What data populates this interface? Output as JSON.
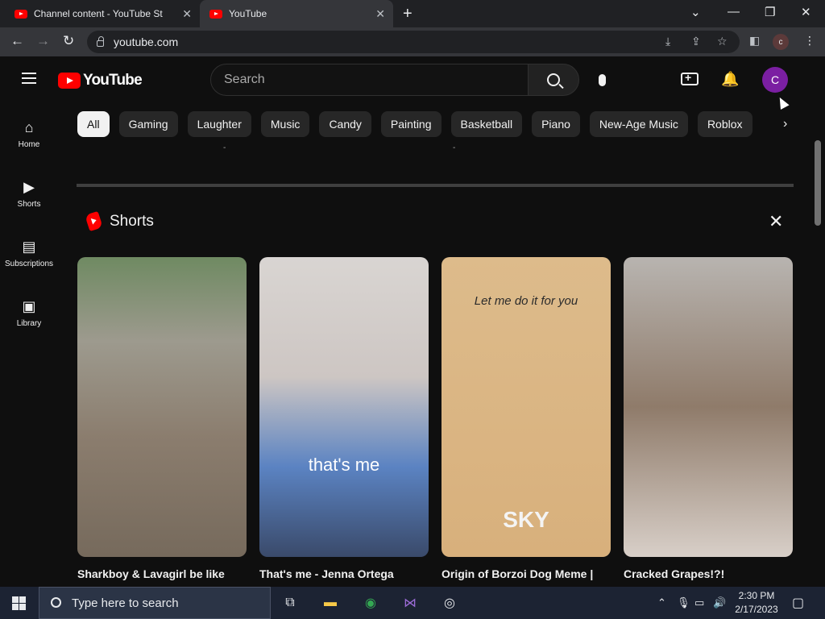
{
  "browser": {
    "tabs": [
      {
        "label": "Channel content - YouTube Studio"
      },
      {
        "label": "YouTube"
      }
    ],
    "url": "youtube.com",
    "profile_initial": "c"
  },
  "header": {
    "logo_text": "YouTube",
    "search_placeholder": "Search",
    "avatar_initial": "C"
  },
  "guide": [
    {
      "label": "Home",
      "icon": "home-icon"
    },
    {
      "label": "Shorts",
      "icon": "shorts-icon"
    },
    {
      "label": "Subscriptions",
      "icon": "subscriptions-icon"
    },
    {
      "label": "Library",
      "icon": "library-icon"
    }
  ],
  "chips": [
    "All",
    "Gaming",
    "Laughter",
    "Music",
    "Candy",
    "Painting",
    "Basketball",
    "Piano",
    "New-Age Music",
    "Roblox"
  ],
  "shorts": {
    "title": "Shorts",
    "items": [
      {
        "title": "Sharkboy & Lavagirl be like",
        "overlay": ""
      },
      {
        "title": "That's me - Jenna Ortega",
        "overlay": "that's me"
      },
      {
        "title": "Origin of Borzoi Dog Meme |",
        "overlay": "Let me do it for you",
        "overlay2": "SKY"
      },
      {
        "title": "Cracked Grapes!?!",
        "overlay": ""
      }
    ]
  },
  "taskbar": {
    "search_placeholder": "Type here to search",
    "time": "2:30 PM",
    "date": "2/17/2023"
  },
  "colors": {
    "brand": "#ff0000",
    "background": "#0f0f0f",
    "avatar": "#7b1fa2"
  }
}
